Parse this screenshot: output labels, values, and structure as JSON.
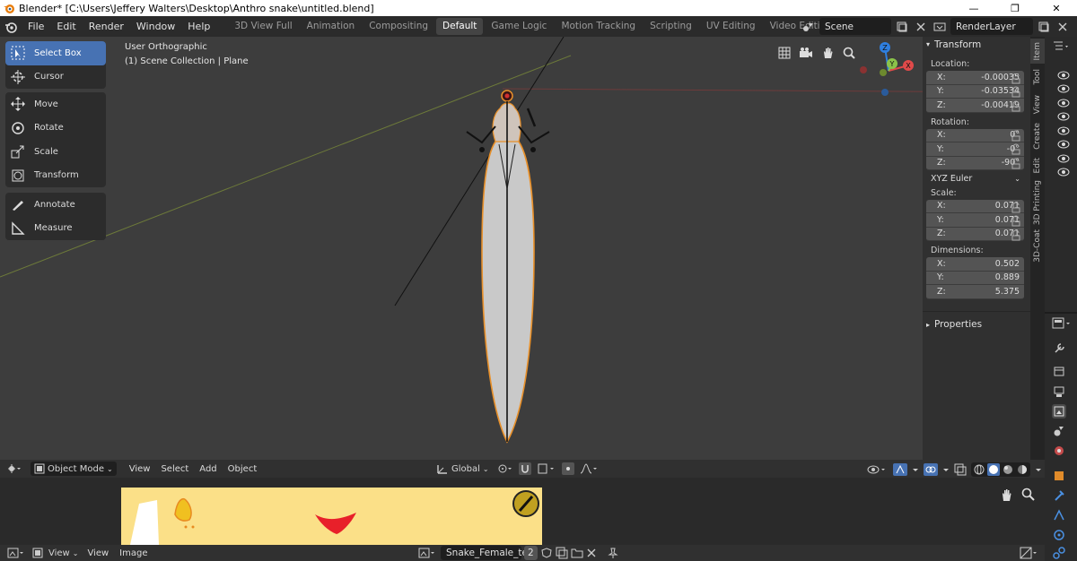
{
  "window": {
    "title": "Blender* [C:\\Users\\Jeffery Walters\\Desktop\\Anthro snake\\untitled.blend]",
    "minimize": "—",
    "maximize": "❐",
    "close": "✕"
  },
  "menus": [
    "File",
    "Edit",
    "Render",
    "Window",
    "Help"
  ],
  "workspaces": {
    "tabs": [
      "3D View Full",
      "Animation",
      "Compositing",
      "Default",
      "Game Logic",
      "Motion Tracking",
      "Scripting",
      "UV Editing",
      "Video Editing"
    ],
    "active": "Default",
    "add": "+"
  },
  "scene": {
    "name": "Scene",
    "render_layer": "RenderLayer"
  },
  "viewport": {
    "view_name": "User Orthographic",
    "collection": "(1) Scene Collection | Plane",
    "gizmo_axes": {
      "x": "X",
      "y": "Y",
      "z": "Z"
    },
    "colors": {
      "background": "#3d3d3d",
      "x_axis": "#e04a4a",
      "y_axis": "#8bc34a",
      "z_axis": "#2f7fe0",
      "selection": "#e8902a"
    }
  },
  "toolbar": {
    "tools": [
      {
        "label": "Select Box",
        "icon": "select-box-icon",
        "active": true
      },
      {
        "label": "Cursor",
        "icon": "cursor-icon"
      },
      {
        "label": "Move",
        "icon": "move-icon"
      },
      {
        "label": "Rotate",
        "icon": "rotate-icon"
      },
      {
        "label": "Scale",
        "icon": "scale-icon"
      },
      {
        "label": "Transform",
        "icon": "transform-icon"
      },
      {
        "label": "Annotate",
        "icon": "annotate-icon"
      },
      {
        "label": "Measure",
        "icon": "measure-icon"
      }
    ]
  },
  "npanel": {
    "transform_header": "Transform",
    "location_label": "Location:",
    "location": {
      "x": "-0.00035",
      "y": "-0.03534",
      "z": "-0.00419"
    },
    "rotation_label": "Rotation:",
    "rotation": {
      "x": "0°",
      "y": "-0°",
      "z": "-90°"
    },
    "rotation_mode": "XYZ Euler",
    "scale_label": "Scale:",
    "scale": {
      "x": "0.071",
      "y": "0.071",
      "z": "0.071"
    },
    "dimensions_label": "Dimensions:",
    "dimensions": {
      "x": "0.502",
      "y": "0.889",
      "z": "5.375"
    },
    "axis": {
      "x": "X:",
      "y": "Y:",
      "z": "Z:"
    },
    "properties_header": "Properties"
  },
  "sidebar_tabs": [
    "Item",
    "Tool",
    "View",
    "Create",
    "Edit",
    "3D Printing",
    "3D-Coat"
  ],
  "viewport_header": {
    "mode": "Object Mode",
    "menus": [
      "View",
      "Select",
      "Add",
      "Object"
    ],
    "orientation": "Global"
  },
  "image_editor": {
    "header_menus": [
      "View",
      "View",
      "Image"
    ],
    "image_name": "Snake_Female_tex",
    "users": "2"
  }
}
